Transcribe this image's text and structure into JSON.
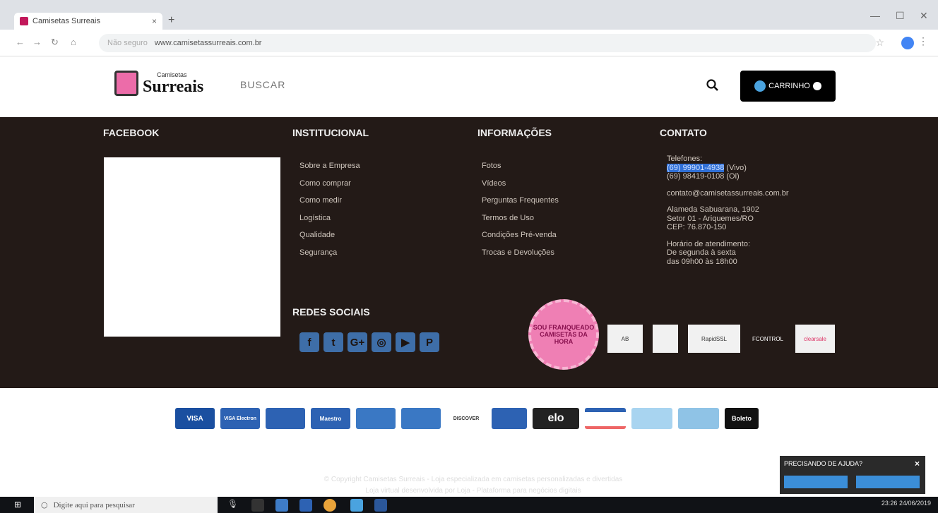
{
  "browser": {
    "tab_title": "Camisetas Surreais",
    "tab_close": "×",
    "new_tab": "+",
    "not_secure": "Não seguro",
    "url": "www.camisetassurreais.com.br"
  },
  "header": {
    "logo_small": "Camisetas",
    "logo_big": "Surreais",
    "search_placeholder": "BUSCAR",
    "cart_label": "CARRINHO"
  },
  "footer": {
    "facebook_title": "FACEBOOK",
    "institucional_title": "INSTITUCIONAL",
    "institucional_links": [
      "Sobre a Empresa",
      "Como comprar",
      "Como medir",
      "Logística",
      "Qualidade",
      "Segurança"
    ],
    "informacoes_title": "INFORMAÇÕES",
    "informacoes_links": [
      "Fotos",
      "Vídeos",
      "Perguntas Frequentes",
      "Termos de Uso",
      "Condições Pré-venda",
      "Trocas e Devoluções"
    ],
    "contato_title": "CONTATO",
    "telefones_label": "Telefones:",
    "phone1": "(69) 99901-4938",
    "phone1_suffix": " (Vivo)",
    "phone2": "(69) 98419-0108 (Oi)",
    "email": "contato@camisetassurreais.com.br",
    "address1": "Alameda Sabuarana, 1902",
    "address2": "Setor 01 - Ariquemes/RO",
    "address3": "CEP: 76.870-150",
    "hours_title": "Horário de atendimento:",
    "hours1": "De segunda à sexta",
    "hours2": "das 09h00 às 18h00",
    "social_title": "REDES SOCIAIS",
    "seal_text": "SOU FRANQUEADO CAMISETAS DA HORA",
    "badges": [
      "AB",
      "",
      "RapidSSL",
      "FCONTROL",
      "clearsale"
    ]
  },
  "payments": [
    "VISA",
    "VISA Electron",
    "",
    "Maestro",
    "",
    "",
    "DISCOVER",
    "",
    "elo",
    "",
    "",
    "",
    "Boleto"
  ],
  "copyright": "© Copyright Camisetas Surreais - Loja especializada em camisetas personalizadas e divertidas",
  "powered": "Loja virtual desenvolvida por Loja - Plataforma para negócios digitais",
  "help": {
    "title": "PRECISANDO DE AJUDA?",
    "close": "×"
  },
  "taskbar": {
    "search_placeholder": "Digite aqui para pesquisar",
    "time": "23:26",
    "date": "24/06/2019"
  },
  "colors": {
    "footer_bg": "#231a17",
    "brand_pink": "#ec6ca9",
    "cart_bg": "#000000"
  }
}
